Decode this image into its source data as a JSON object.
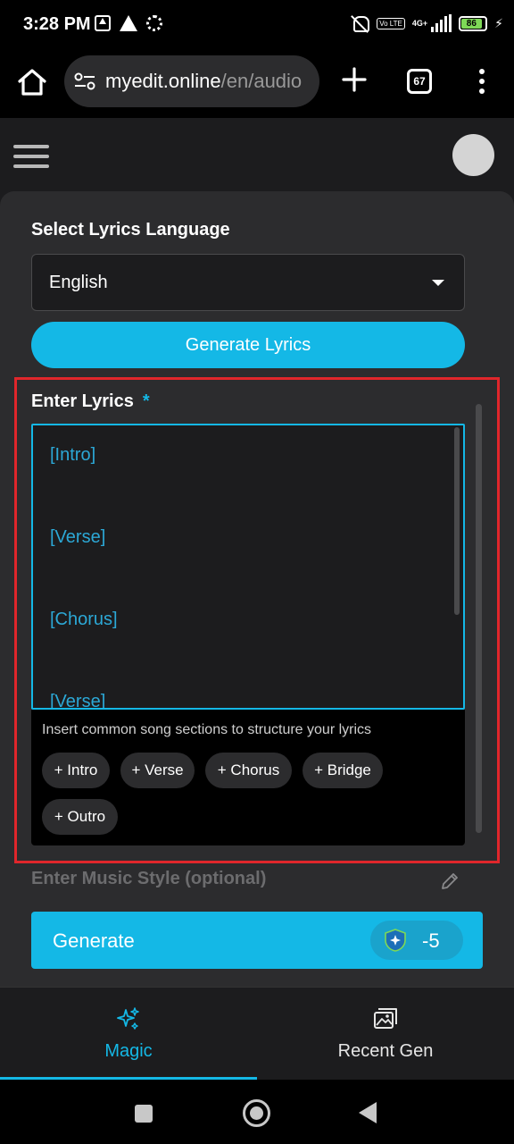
{
  "status_bar": {
    "time": "3:28 PM",
    "network": "4G+",
    "volte": "Vo LTE",
    "battery": "86",
    "icons": [
      "upload-icon",
      "warning-icon",
      "settings-icon",
      "mute-icon",
      "volte-icon",
      "signal-icon",
      "battery-icon",
      "charging-icon"
    ]
  },
  "browser": {
    "url_domain": "myedit.online",
    "url_path": "/en/audio",
    "tab_count": "67"
  },
  "page": {
    "language_label": "Select Lyrics Language",
    "language_value": "English",
    "generate_lyrics_label": "Generate Lyrics",
    "lyrics_label": "Enter Lyrics",
    "required_marker": "*",
    "lyrics_lines": [
      "[Intro]",
      "[Verse]",
      "[Chorus]",
      "[Verse]"
    ],
    "sections_hint": "Insert common song sections to structure your lyrics",
    "section_chips": [
      "+ Intro",
      "+ Verse",
      "+ Chorus",
      "+ Bridge",
      "+ Outro"
    ],
    "music_style_label": "Enter Music Style (optional)",
    "generate_label": "Generate",
    "credit_cost": "-5"
  },
  "bottom_nav": {
    "items": [
      {
        "label": "Magic",
        "icon": "sparkles-icon",
        "active": true
      },
      {
        "label": "Recent Gen",
        "icon": "gallery-icon",
        "active": false
      }
    ]
  },
  "colors": {
    "accent": "#14b8e6",
    "highlight": "#e0262b",
    "background": "#1c1c1e",
    "panel": "#2c2c2e"
  }
}
